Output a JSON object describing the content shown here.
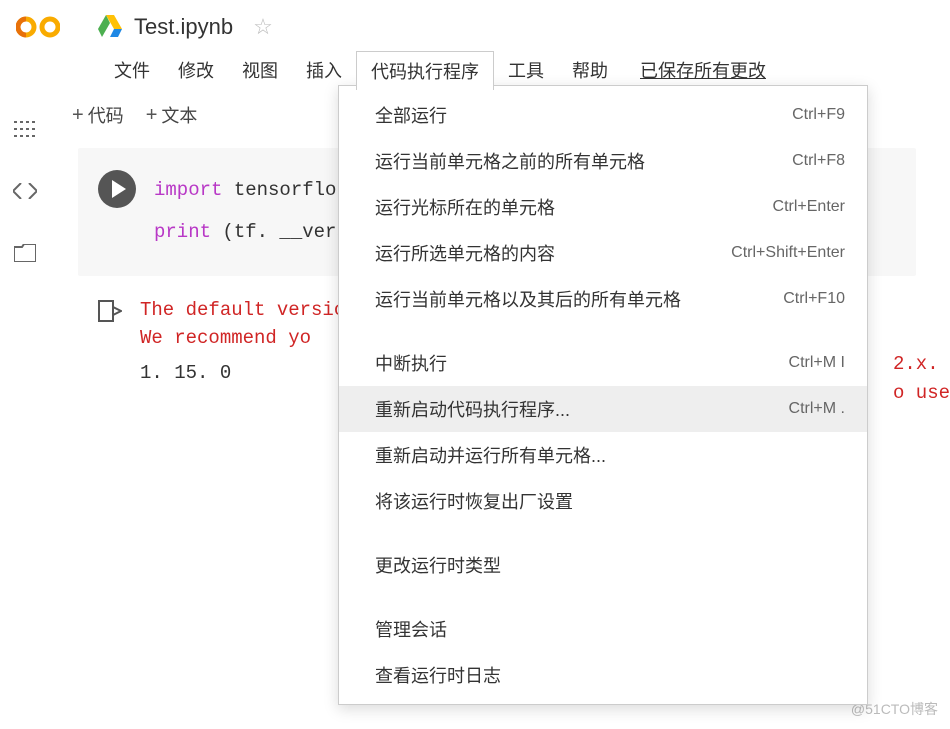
{
  "header": {
    "title": "Test.ipynb"
  },
  "menubar": {
    "items": [
      "文件",
      "修改",
      "视图",
      "插入",
      "代码执行程序",
      "工具",
      "帮助"
    ],
    "save_text": "已保存所有更改"
  },
  "toolbar": {
    "code_btn": "代码",
    "text_btn": "文本"
  },
  "cell": {
    "code_line1_kw": "import",
    "code_line1_rest": "  tensorflo",
    "code_line2_kw": "print",
    "code_line2_rest": " (tf. __vers"
  },
  "output": {
    "warn_line1": "The default version",
    "warn_line2": "We recommend yo",
    "version": "1. 15. 0",
    "right_frag1": "2.x.",
    "right_frag2": "o use"
  },
  "dropdown": {
    "items": [
      {
        "label": "全部运行",
        "shortcut": "Ctrl+F9",
        "hl": false
      },
      {
        "label": "运行当前单元格之前的所有单元格",
        "shortcut": "Ctrl+F8",
        "hl": false
      },
      {
        "label": "运行光标所在的单元格",
        "shortcut": "Ctrl+Enter",
        "hl": false
      },
      {
        "label": "运行所选单元格的内容",
        "shortcut": "Ctrl+Shift+Enter",
        "hl": false
      },
      {
        "label": "运行当前单元格以及其后的所有单元格",
        "shortcut": "Ctrl+F10",
        "hl": false
      }
    ],
    "group2": [
      {
        "label": "中断执行",
        "shortcut": "Ctrl+M I",
        "hl": false
      },
      {
        "label": "重新启动代码执行程序...",
        "shortcut": "Ctrl+M .",
        "hl": true
      },
      {
        "label": "重新启动并运行所有单元格...",
        "shortcut": "",
        "hl": false
      },
      {
        "label": "将该运行时恢复出厂设置",
        "shortcut": "",
        "hl": false
      }
    ],
    "group3": [
      {
        "label": "更改运行时类型",
        "shortcut": "",
        "hl": false
      }
    ],
    "group4": [
      {
        "label": "管理会话",
        "shortcut": "",
        "hl": false
      },
      {
        "label": "查看运行时日志",
        "shortcut": "",
        "hl": false
      }
    ]
  },
  "watermark": "@51CTO博客"
}
